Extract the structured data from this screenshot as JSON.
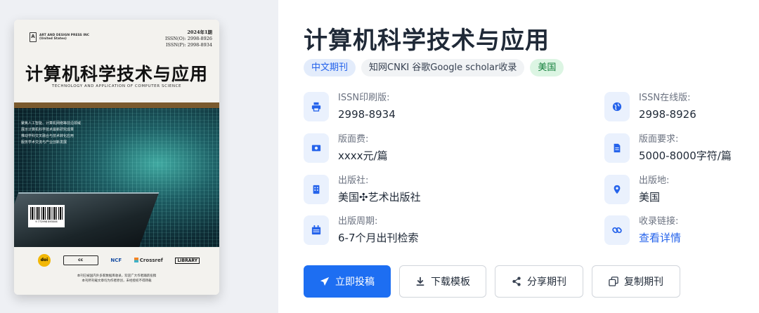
{
  "journal": {
    "title": "计算机科学技术与应用",
    "tags": [
      "中文期刊",
      "知网CNKI 谷歌Google scholar收录",
      "美国"
    ]
  },
  "cover": {
    "publisher": "ART AND DESIGN PRESS INC",
    "publisher_sub": "(United States)",
    "issue": "2024年1期",
    "issn_online": "ISSN(O): 2998-8926",
    "issn_print": "ISSN(P): 2998-8934",
    "title": "计算机科学技术与应用",
    "subtitle": "TECHNOLOGY AND APPLICATION OF COMPUTER SCIENCE",
    "blurb": [
      "聚焦人工智能、计算机网络等前沿领域",
      "展示计算机科学技术最新研究成果",
      "推动学科交叉融合与技术转化应用",
      "服务学术交流与产业创新发展"
    ],
    "barcode_number": "9 772998 893006",
    "logos": [
      "doi",
      "cc",
      "NCF",
      "Crossref",
      "LIBRARY"
    ],
    "footer_lines": [
      "本刊已被国内外多家数据库收录，欢迎广大作者踊跃投稿",
      "本刊所刊载文章均为作者原创，未经授权不得转载"
    ]
  },
  "info_left": [
    {
      "icon": "printer-icon",
      "label": "ISSN印刷版:",
      "value": "2998-8934"
    },
    {
      "icon": "banknote-icon",
      "label": "版面费:",
      "value": "xxxx元/篇"
    },
    {
      "icon": "building-icon",
      "label": "出版社:",
      "value": "美国✣艺术出版社"
    },
    {
      "icon": "calendar-icon",
      "label": "出版周期:",
      "value": "6-7个月出刊检索"
    }
  ],
  "info_right": [
    {
      "icon": "globe-icon",
      "label": "ISSN在线版:",
      "value": "2998-8926"
    },
    {
      "icon": "document-icon",
      "label": "版面要求:",
      "value": "5000-8000字符/篇"
    },
    {
      "icon": "location-pin-icon",
      "label": "出版地:",
      "value": "美国"
    },
    {
      "icon": "link-icon",
      "label": "收录链接:",
      "value": "查看详情"
    }
  ],
  "buttons": {
    "submit": "立即投稿",
    "download": "下载模板",
    "share": "分享期刊",
    "copy": "复制期刊"
  },
  "colors": {
    "primary": "#1d6ef2",
    "tag_blue_bg": "#e3ecfb",
    "tag_green_bg": "#dcf5e3",
    "left_panel_bg": "#eef0f4"
  }
}
